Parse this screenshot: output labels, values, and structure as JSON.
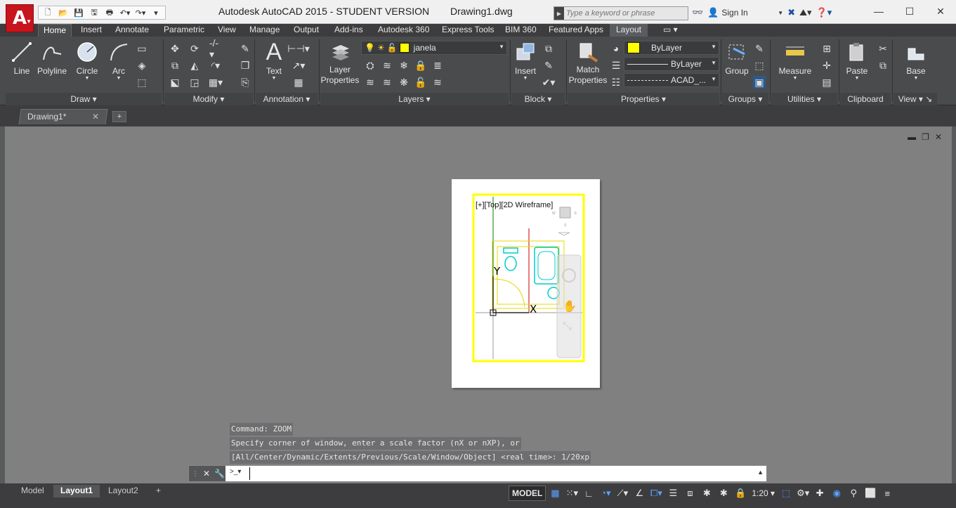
{
  "titlebar": {
    "title": "Autodesk AutoCAD 2015 - STUDENT VERSION",
    "document": "Drawing1.dwg",
    "search_placeholder": "Type a keyword or phrase",
    "sign_in": "Sign In",
    "app_letter": "A"
  },
  "ribbon": {
    "tabs": [
      "Home",
      "Insert",
      "Annotate",
      "Parametric",
      "View",
      "Manage",
      "Output",
      "Add-ins",
      "Autodesk 360",
      "Express Tools",
      "BIM 360",
      "Featured Apps",
      "Layout"
    ],
    "active_tab": "Home",
    "draw": {
      "line": "Line",
      "polyline": "Polyline",
      "circle": "Circle",
      "arc": "Arc",
      "title": "Draw"
    },
    "modify": {
      "title": "Modify"
    },
    "annotation": {
      "text": "Text",
      "title": "Annotation"
    },
    "layers": {
      "layer_properties_1": "Layer",
      "layer_properties_2": "Properties",
      "current_layer": "janela",
      "title": "Layers"
    },
    "block": {
      "insert": "Insert",
      "title": "Block"
    },
    "properties": {
      "match_1": "Match",
      "match_2": "Properties",
      "color": "ByLayer",
      "lineweight": "ByLayer",
      "linetype": "ACAD_...",
      "title": "Properties"
    },
    "groups": {
      "group": "Group",
      "title": "Groups"
    },
    "utilities": {
      "measure": "Measure",
      "title": "Utilities"
    },
    "clipboard": {
      "paste": "Paste",
      "title": "Clipboard"
    },
    "view": {
      "base": "Base",
      "title": "View"
    },
    "layer_color": "#ffff00"
  },
  "filetabs": {
    "drawing": "Drawing1*"
  },
  "drawing": {
    "viewport_label": "[+][Top][2D Wireframe]",
    "viewport_border_color": "#ffff00"
  },
  "command": {
    "history": [
      "Command: ZOOM",
      "Specify corner of window, enter a scale factor (nX or nXP), or",
      "[All/Center/Dynamic/Extents/Previous/Scale/Window/Object] <real time>: 1/20xp"
    ],
    "input_value": ""
  },
  "status": {
    "layout_tabs": [
      "Model",
      "Layout1",
      "Layout2"
    ],
    "active_layout": "Layout1",
    "model": "MODEL",
    "scale": "1:20"
  }
}
